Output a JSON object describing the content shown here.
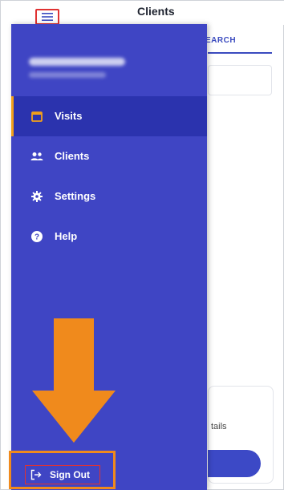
{
  "header": {
    "title": "Clients",
    "menu_icon": "hamburger-menu-icon"
  },
  "tabs": {
    "search_label": "EARCH"
  },
  "background_card": {
    "text": "tails"
  },
  "drawer": {
    "nav": [
      {
        "label": "Visits",
        "icon": "calendar-icon",
        "active": true
      },
      {
        "label": "Clients",
        "icon": "people-icon",
        "active": false
      },
      {
        "label": "Settings",
        "icon": "gear-icon",
        "active": false
      },
      {
        "label": "Help",
        "icon": "help-icon",
        "active": false
      }
    ],
    "sign_out_label": "Sign Out",
    "sign_out_icon": "sign-out-icon"
  },
  "colors": {
    "drawer_bg": "#3f45c4",
    "drawer_active_bg": "#2b33ae",
    "active_indicator": "#f2a01a",
    "annotation_orange": "#f08a1c",
    "annotation_red": "#e03232",
    "accent_blue": "#3b4bbf"
  }
}
